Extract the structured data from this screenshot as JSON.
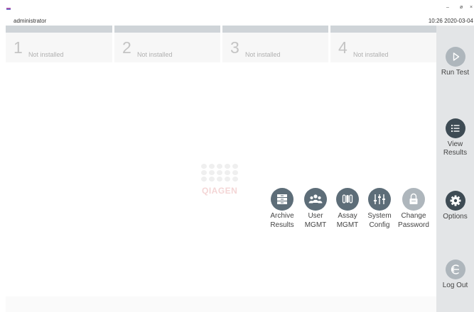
{
  "window": {
    "user": "administrator",
    "datetime": "10:26 2020-03-04",
    "controls": [
      "–",
      "ø",
      "×"
    ]
  },
  "modules": [
    {
      "number": "1",
      "status": "Not installed"
    },
    {
      "number": "2",
      "status": "Not installed"
    },
    {
      "number": "3",
      "status": "Not installed"
    },
    {
      "number": "4",
      "status": "Not installed"
    }
  ],
  "watermark": {
    "brand": "QIAGEN"
  },
  "options": [
    {
      "line1": "Archive",
      "line2": "Results",
      "icon": "archive-icon"
    },
    {
      "line1": "User",
      "line2": "MGMT",
      "icon": "users-icon"
    },
    {
      "line1": "Assay",
      "line2": "MGMT",
      "icon": "assay-tubes-icon"
    },
    {
      "line1": "System",
      "line2": "Config",
      "icon": "sliders-icon"
    },
    {
      "line1": "Change",
      "line2": "Password",
      "icon": "lock-icon"
    }
  ],
  "sidebar": {
    "run_test": {
      "label": "Run Test",
      "icon": "play-icon"
    },
    "view_results": {
      "line1": "View",
      "line2": "Results",
      "icon": "list-icon"
    },
    "options": {
      "label": "Options",
      "icon": "gear-icon"
    },
    "logout": {
      "label": "Log Out",
      "icon": "logout-icon"
    }
  },
  "colors": {
    "icon_dark": "#5d6d78",
    "icon_muted": "#aeb6bc",
    "sidebar_bg": "#e3e5e7",
    "tab_bar": "#cfd4d8"
  }
}
